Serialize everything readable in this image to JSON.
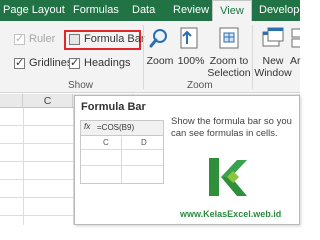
{
  "tabs": [
    {
      "label": "Page Layout"
    },
    {
      "label": "Formulas"
    },
    {
      "label": "Data"
    },
    {
      "label": "Review"
    },
    {
      "label": "View",
      "active": true
    },
    {
      "label": "Developer"
    }
  ],
  "show_group": {
    "label": "Show",
    "ruler": {
      "label": "Ruler",
      "checked": true,
      "disabled": true
    },
    "formula_bar": {
      "label": "Formula Bar",
      "checked": false
    },
    "gridlines": {
      "label": "Gridlines",
      "checked": true
    },
    "headings": {
      "label": "Headings",
      "checked": true
    }
  },
  "zoom_group": {
    "label": "Zoom",
    "zoom": {
      "label": "Zoom",
      "icon": "magnifier-icon"
    },
    "zoom_100": {
      "label": "100%",
      "icon": "100-percent-icon"
    },
    "zoom_selection": {
      "label": "Zoom to\nSelection",
      "icon": "zoom-to-selection-icon"
    }
  },
  "window_group": {
    "new_window": {
      "label": "New\nWindow",
      "icon": "new-window-icon"
    },
    "arrange": {
      "label": "Ar",
      "icon": "arrange-all-icon"
    }
  },
  "sheet": {
    "column_headers": [
      "C",
      "D"
    ]
  },
  "tooltip": {
    "title": "Formula Bar",
    "description": "Show the formula bar so you can see formulas in cells.",
    "preview": {
      "fx_label": "fx",
      "formula": "=COS(B9)",
      "columns": [
        "C",
        "D"
      ]
    },
    "watermark": "www.KelasExcel.web.id"
  },
  "colors": {
    "tab_bar": "#217346",
    "highlight": "#e0262a",
    "brand_logo": "#2f8f3b"
  }
}
